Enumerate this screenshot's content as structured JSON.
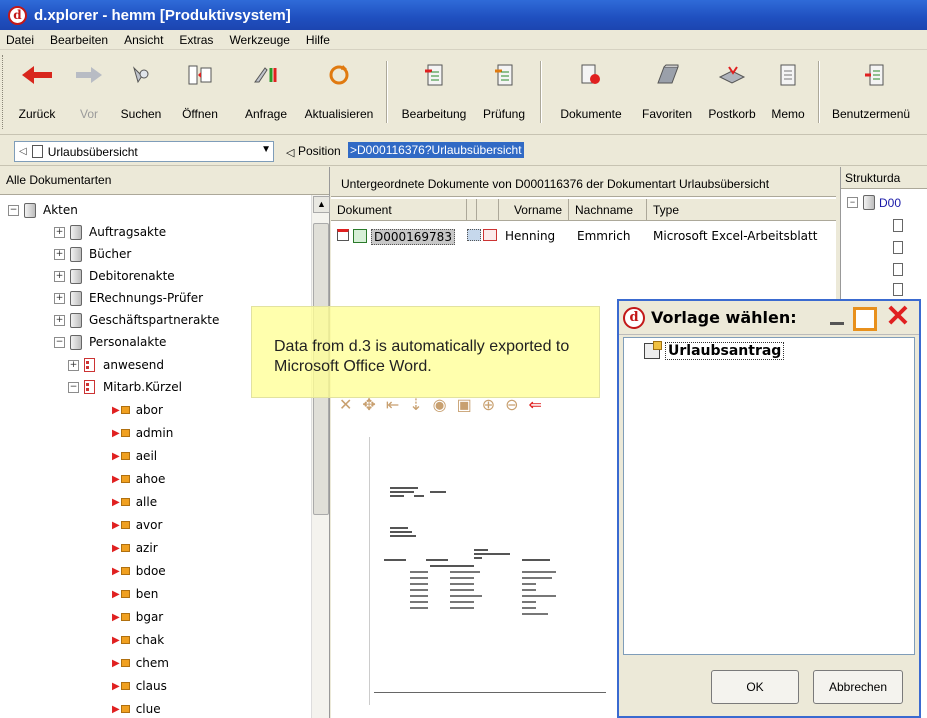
{
  "window": {
    "title": "d.xplorer - hemm [Produktivsystem]",
    "logo_letter": "d"
  },
  "menu": [
    "Datei",
    "Bearbeiten",
    "Ansicht",
    "Extras",
    "Werkzeuge",
    "Hilfe"
  ],
  "toolbar": {
    "back": "Zurück",
    "forward": "Vor",
    "search": "Suchen",
    "open": "Öffnen",
    "query": "Anfrage",
    "refresh": "Aktualisieren",
    "edit": "Bearbeitung",
    "check": "Prüfung",
    "documents": "Dokumente",
    "favorites": "Favoriten",
    "inbox": "Postkorb",
    "memo": "Memo",
    "user_menu": "Benutzermenü"
  },
  "address": {
    "combo_value": "Urlaubsübersicht",
    "position_label": "Position",
    "position_value": ">D000116376?Urlaubsübersicht"
  },
  "left_pane": {
    "header": "Alle Dokumentarten",
    "tree": {
      "root": "Akten",
      "folders": [
        "Auftragsakte",
        "Bücher",
        "Debitorenakte",
        "ERechnungs-Prüfer",
        "Geschäftspartnerakte",
        "Personalakte"
      ],
      "person_nodes": [
        "anwesend",
        "Mitarb.Kürzel"
      ],
      "leaves": [
        "abor",
        "admin",
        "aeil",
        "ahoe",
        "alle",
        "avor",
        "azir",
        "bdoe",
        "ben",
        "bgar",
        "chak",
        "chem",
        "claus",
        "clue"
      ]
    }
  },
  "middle_pane": {
    "title": "Untergeordnete Dokumente von D000116376 der Dokumentart Urlaubsübersicht",
    "columns": [
      "Dokument",
      "Vorname",
      "Nachname",
      "Type"
    ],
    "rows": [
      {
        "id": "D000169783",
        "vorname": "Henning",
        "nachname": "Emmrich",
        "type": "Microsoft Excel-Arbeitsblatt"
      }
    ]
  },
  "right_pane": {
    "header": "Strukturda",
    "root": "D00"
  },
  "tooltip": {
    "line1": "Data from d.3 is automatically exported to",
    "line2": "Microsoft Office Word."
  },
  "dialog": {
    "title": "Vorlage wählen:",
    "items": [
      "Urlaubsantrag"
    ],
    "ok": "OK",
    "cancel": "Abbrechen"
  },
  "colors": {
    "titlebar": "#1f4fbf",
    "selection": "#316ac5",
    "accent_red": "#c31818"
  }
}
